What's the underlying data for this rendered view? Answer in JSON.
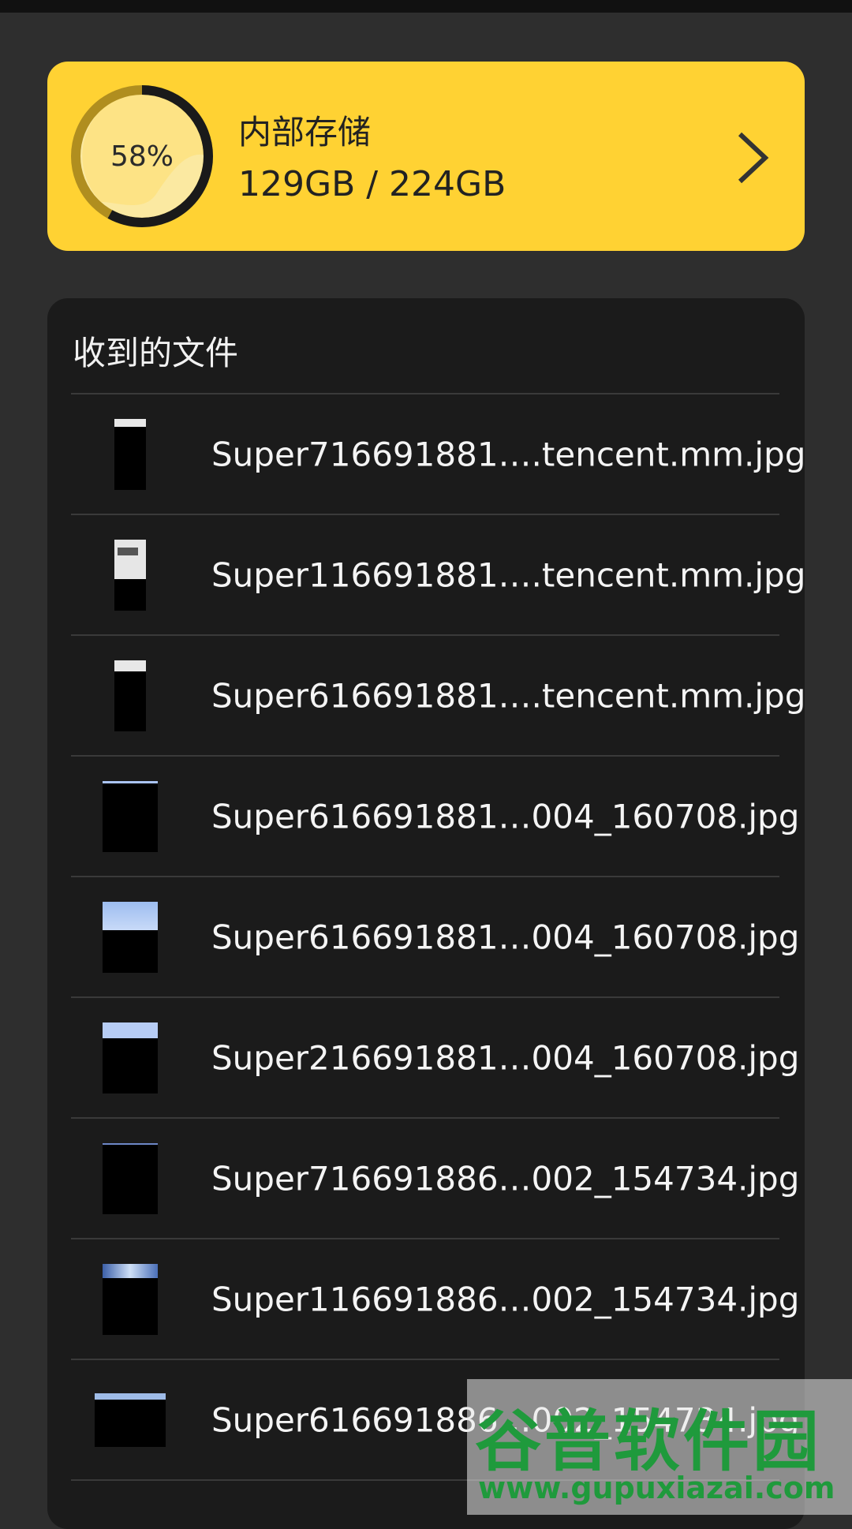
{
  "storage": {
    "percent_label": "58%",
    "used_fraction": 0.58,
    "title": "内部存储",
    "usage": "129GB / 224GB"
  },
  "files": {
    "title": "收到的文件",
    "items": [
      {
        "name": "Super716691881….tencent.mm.jpg"
      },
      {
        "name": "Super116691881….tencent.mm.jpg"
      },
      {
        "name": "Super616691881….tencent.mm.jpg"
      },
      {
        "name": "Super616691881…004_160708.jpg"
      },
      {
        "name": "Super616691881…004_160708.jpg"
      },
      {
        "name": "Super216691881…004_160708.jpg"
      },
      {
        "name": "Super716691886…002_154734.jpg"
      },
      {
        "name": "Super116691886…002_154734.jpg"
      },
      {
        "name": "Super616691886…002_154734.jpg"
      }
    ]
  },
  "watermark": {
    "brand": "谷普软件园",
    "url": "www.gupuxiazai.com"
  },
  "colors": {
    "accent": "#ffd233",
    "card_bg": "#1b1b1b",
    "page_bg": "#2e2e2e"
  }
}
